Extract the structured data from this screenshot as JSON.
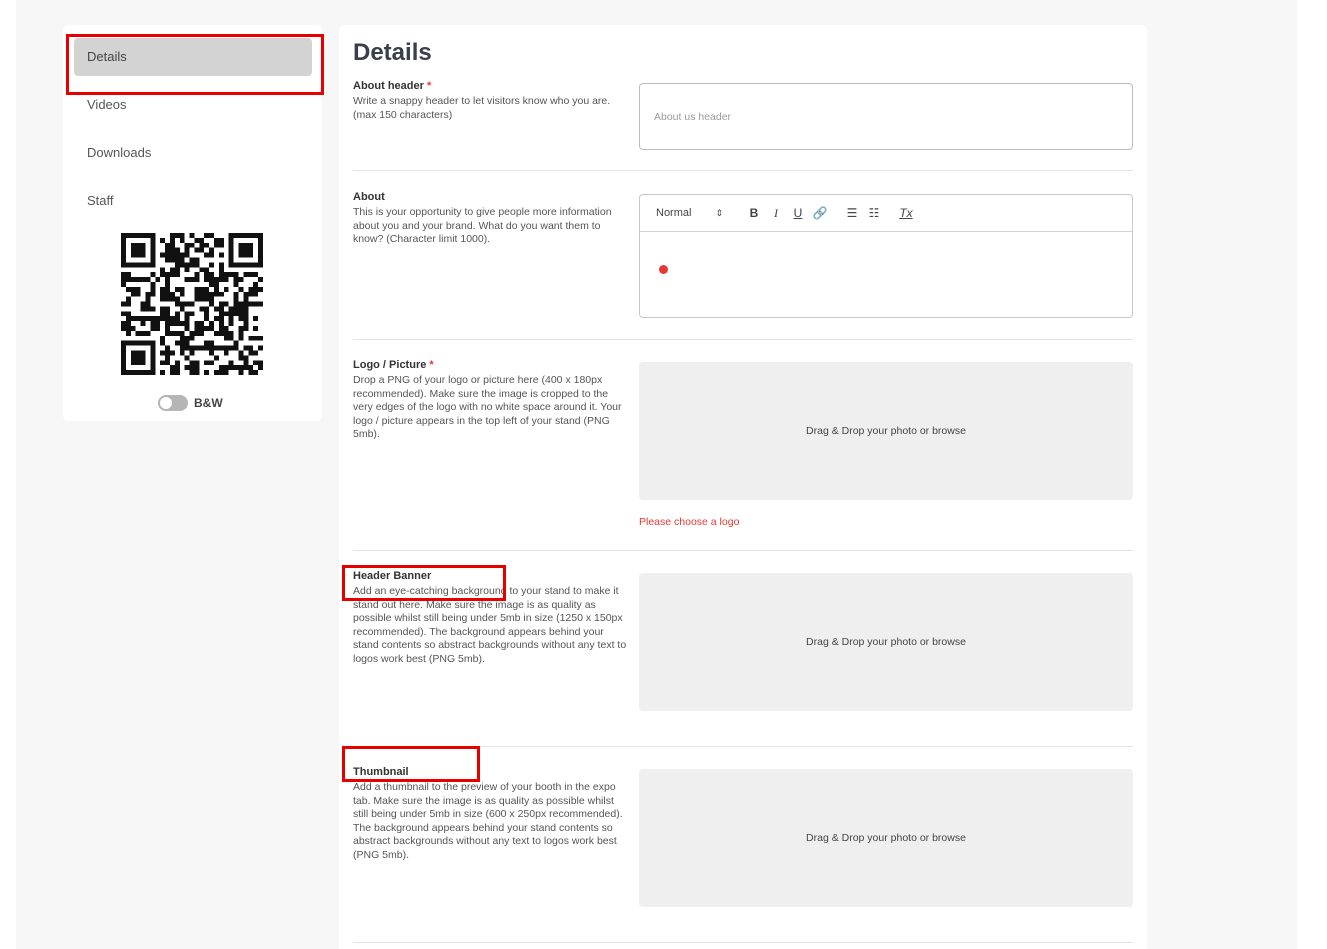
{
  "sidebar": {
    "items": [
      {
        "label": "Details",
        "active": true
      },
      {
        "label": "Videos",
        "active": false
      },
      {
        "label": "Downloads",
        "active": false
      },
      {
        "label": "Staff",
        "active": false
      }
    ],
    "qr_icon": "qr-code",
    "bw_toggle_label": "B&W",
    "bw_toggle_on": false
  },
  "main": {
    "title": "Details",
    "about_header": {
      "label": "About header",
      "required_mark": "*",
      "description": "Write a snappy header to let visitors know who you are. (max 150 characters)",
      "placeholder": "About us header",
      "value": ""
    },
    "about": {
      "label": "About",
      "description": "This is your opportunity to give people more information about you and your brand. What do you want them to know? (Character limit 1000).",
      "toolbar": {
        "format_select": "Normal",
        "format_select_icon": "up-down-arrows",
        "buttons": [
          "B",
          "I",
          "U",
          "🔗",
          "☰",
          "☷",
          "Tx"
        ]
      }
    },
    "logo": {
      "label": "Logo / Picture",
      "required_mark": "*",
      "description": "Drop a PNG of your logo or picture here (400 x 180px recommended). Make sure the image is cropped to the very edges of the logo with no white space around it. Your logo / picture appears in the top left of your stand (PNG 5mb).",
      "dropzone_text": "Drag & Drop your photo or browse",
      "error": "Please choose a logo"
    },
    "header_banner": {
      "label": "Header Banner",
      "description": "Add an eye-catching background to your stand to make it stand out here. Make sure the image is as quality as possible whilst still being under 5mb in size (1250 x 150px recommended). The background appears behind your stand contents so abstract backgrounds without any text to logos work best (PNG 5mb).",
      "dropzone_text": "Drag & Drop your photo or browse"
    },
    "thumbnail": {
      "label": "Thumbnail",
      "description": "Add a thumbnail to the preview of your booth in the expo tab. Make sure the image is as quality as possible whilst still being under 5mb in size (600 x 250px recommended). The background appears behind your stand contents so abstract backgrounds without any text to logos work best (PNG 5mb).",
      "dropzone_text": "Drag & Drop your photo or browse"
    }
  },
  "colors": {
    "accent_red": "#e53935",
    "highlight_red": "#e60000",
    "active_item_bg": "#d3d3d3",
    "dropzone_bg": "#efefef"
  }
}
